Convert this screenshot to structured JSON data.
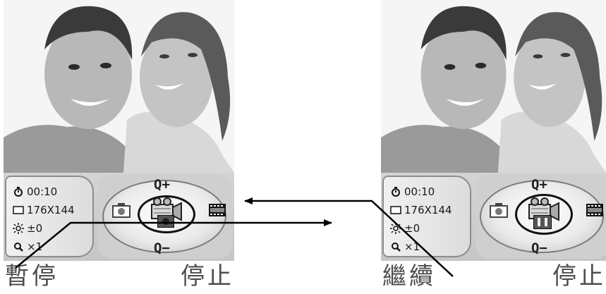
{
  "left_screen": {
    "info": {
      "timer": "00:10",
      "resolution": "176X144",
      "brightness": "±0",
      "zoom": "×1"
    },
    "zoom_in_label": "Q+",
    "zoom_out_label": "Q−",
    "softkey_left": "暫停",
    "softkey_right": "停止"
  },
  "right_screen": {
    "info": {
      "timer": "00:10",
      "resolution": "176X144",
      "brightness": "±0",
      "zoom": "×1"
    },
    "zoom_in_label": "Q+",
    "zoom_out_label": "Q−",
    "softkey_left": "繼續",
    "softkey_right": "停止"
  },
  "icons": {
    "timer": "self-timer-icon",
    "resolution": "frame-size-icon",
    "brightness": "brightness-icon",
    "zoom": "magnifier-icon",
    "camera": "camera-icon",
    "video": "video-camera-icon",
    "film": "film-strip-icon",
    "record_state_left": "record-dot-icon",
    "record_state_right": "pause-bars-icon"
  },
  "colors": {
    "panel_bg": "#c9c9c9",
    "softkey_text": "#4d4d4d",
    "arrow": "#000000"
  }
}
